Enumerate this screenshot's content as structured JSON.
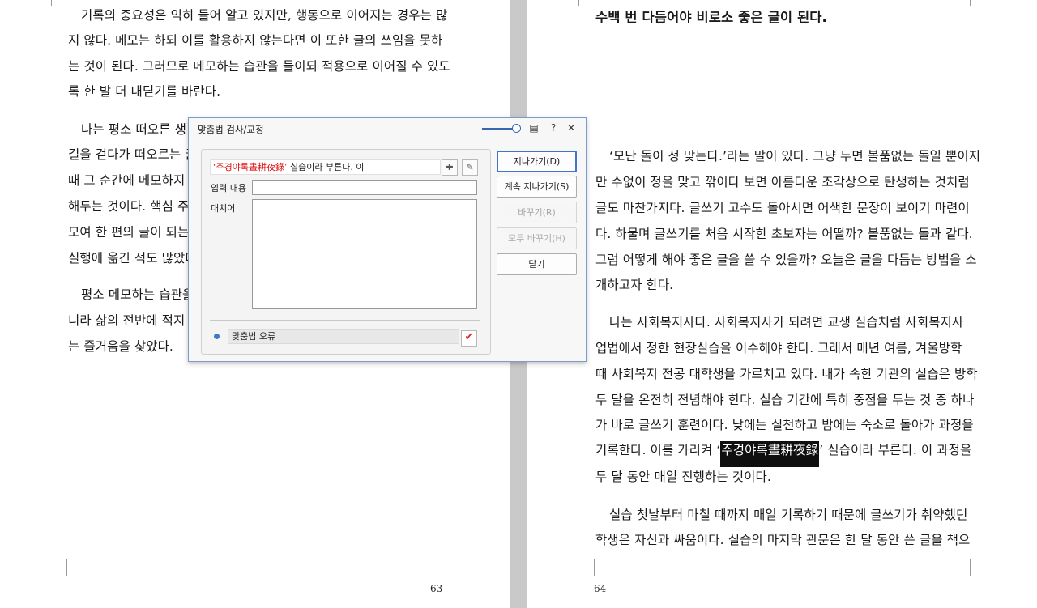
{
  "left_page": {
    "lines": [
      "기록의 중요성은 익히 들어 알고 있지만, 행동으로 이어지는 경우는 많",
      "지 않다. 메모는 하되 이를 활용하지 않는다면 이 또한 글의 쓰임을 못하",
      "는 것이 된다. 그러므로 메모하는 습관을 들이되 적용으로 이어질 수 있도",
      "록 한 발 더 내딛기를 바란다.",
      "나는 평소 떠오른 생",
      "길을 걷다가 떠오르는 글",
      "때 그 순간에 메모하지",
      "해두는 것이다. 핵심 주",
      "모여 한 편의 글이 되는",
      "실행에 옮긴 적도 많았다",
      "평소 메모하는 습관을",
      "니라 삶의 전반에 적지 않",
      "는 즐거움을 찾았다."
    ],
    "page_number": "63"
  },
  "right_page": {
    "heading_line": "수백 번 다듬어야 비로소 좋은 글이 된다.",
    "lines": [
      "‘모난 돌이 정 맞는다.’라는 말이 있다. 그냥 두면 볼품없는 돌일 뿐이지",
      "만 수없이 정을 맞고 깎이다 보면 아름다운 조각상으로 탄생하는 것처럼",
      "글도 마찬가지다. 글쓰기 고수도 돌아서면 어색한 문장이 보이기 마련이",
      "다. 하물며 글쓰기를 처음 시작한 초보자는 어떨까? 볼품없는 돌과 같다.",
      "그럼 어떻게 해야 좋은 글을 쓸 수 있을까? 오늘은 글을 다듬는 방법을 소",
      "개하고자 한다.",
      "나는 사회복지사다. 사회복지사가 되려면 교생 실습처럼 사회복지사",
      "업법에서 정한 현장실습을 이수해야 한다. 그래서 매년 여름, 겨울방학",
      "때 사회복지 전공 대학생을 가르치고 있다. 내가 속한 기관의 실습은 방학",
      "두 달을 온전히 전념해야 한다. 실습 기간에 특히 중점을 두는 것 중 하나",
      "가 바로 글쓰기 훈련이다. 낮에는 실천하고 밤에는 숙소로 돌아가 과정을"
    ],
    "highlight_line": {
      "before": "기록한다. 이를 가리켜 ‘",
      "selected": "주경야록晝耕夜錄",
      "after": "’ 실습이라 부른다. 이 과정을"
    },
    "lines_after": [
      "두 달 동안 매일 진행하는 것이다.",
      "실습 첫날부터 마칠 때까지 매일 기록하기 때문에 글쓰기가 취약했던",
      "학생은 자신과 싸움이다. 실습의 마지막 관문은 한 달 동안 쓴 글을 책으"
    ],
    "page_number": "64"
  },
  "dialog": {
    "title": "맞춤법 검사/교정",
    "sentence": {
      "error_text": "‘주경야록晝耕夜錄’",
      "rest_text": " 실습이라 부른다. 이"
    },
    "input_label": "입력 내용",
    "input_value": "",
    "suggest_label": "대치어",
    "error_type": "맞춤법 오류",
    "buttons": {
      "skip": "지나가기(D)",
      "skip_all": "계속 지나가기(S)",
      "replace": "바꾸기(R)",
      "replace_all": "모두 바꾸기(H)",
      "close": "닫기"
    },
    "icons": [
      "list-icon",
      "help-icon",
      "close-icon",
      "add-dictionary-icon",
      "edit-dictionary-icon",
      "spellcheck-icon"
    ]
  },
  "colors": {
    "error_text": "#dd1111",
    "accent": "#3f76c9",
    "selection_bg": "#0f0f0f",
    "gutter": "#c9c9c9"
  }
}
